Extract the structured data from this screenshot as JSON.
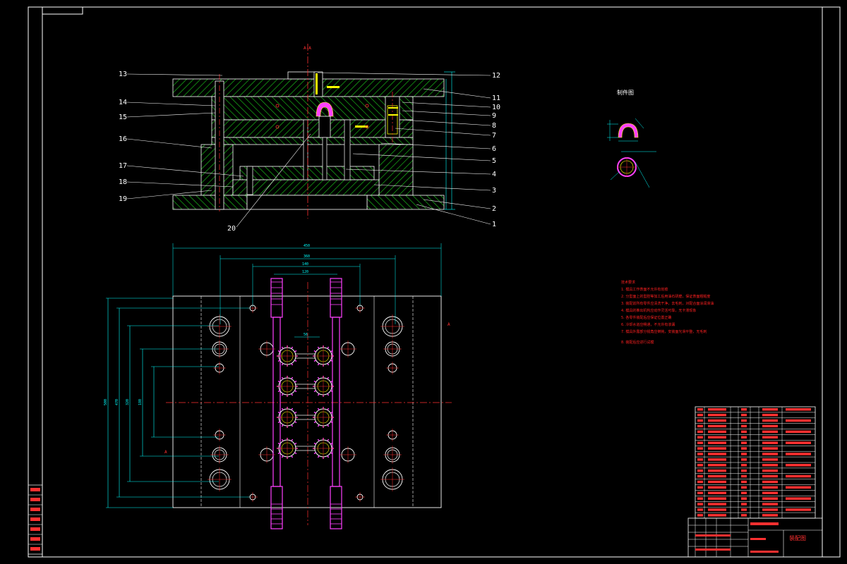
{
  "drawing": {
    "part_view_title": "制件图",
    "title_block_title": "装配图",
    "section_mark": "A-A",
    "section_arrow_letter": "A"
  },
  "leaders_left": [
    "13",
    "14",
    "15",
    "16",
    "17",
    "18",
    "19",
    "20"
  ],
  "leaders_right": [
    "12",
    "11",
    "10",
    "9",
    "8",
    "7",
    "6",
    "5",
    "4",
    "3",
    "2",
    "1"
  ],
  "plan_dimensions": [
    "450",
    "360",
    "140",
    "120",
    "56"
  ],
  "plan_dimensions_vertical": [
    "500",
    "470",
    "320",
    "180"
  ],
  "notes": {
    "title": "技术要求",
    "lines": [
      "1. 模具工作表面不允许有划痕",
      "2. 分型面上的型腔等加工后用油石研磨，保证表面粗糙度",
      "3. 装配前所有零件应清洗干净，去毛刺，对配合面涂润滑油",
      "4. 模具的推出机构应动作灵活可靠，无卡滞现象",
      "5. 各零件装配后应保证位置正确",
      "6. 冷却水道应畅通，不允许有渗漏",
      "7. 模具外露部分锐角应倒钝，安装面光滑平整，无毛刺",
      "8. 装配后应进行试模"
    ]
  },
  "bom_rows": 20,
  "side_strip_cells": 7,
  "colors": {
    "background": "#000000",
    "outline": "#ffffff",
    "hatch": "#00c000",
    "dimension": "#00ffff",
    "centerline": "#ff3030",
    "cooling": "#ff40ff",
    "part": "#ffff00"
  }
}
